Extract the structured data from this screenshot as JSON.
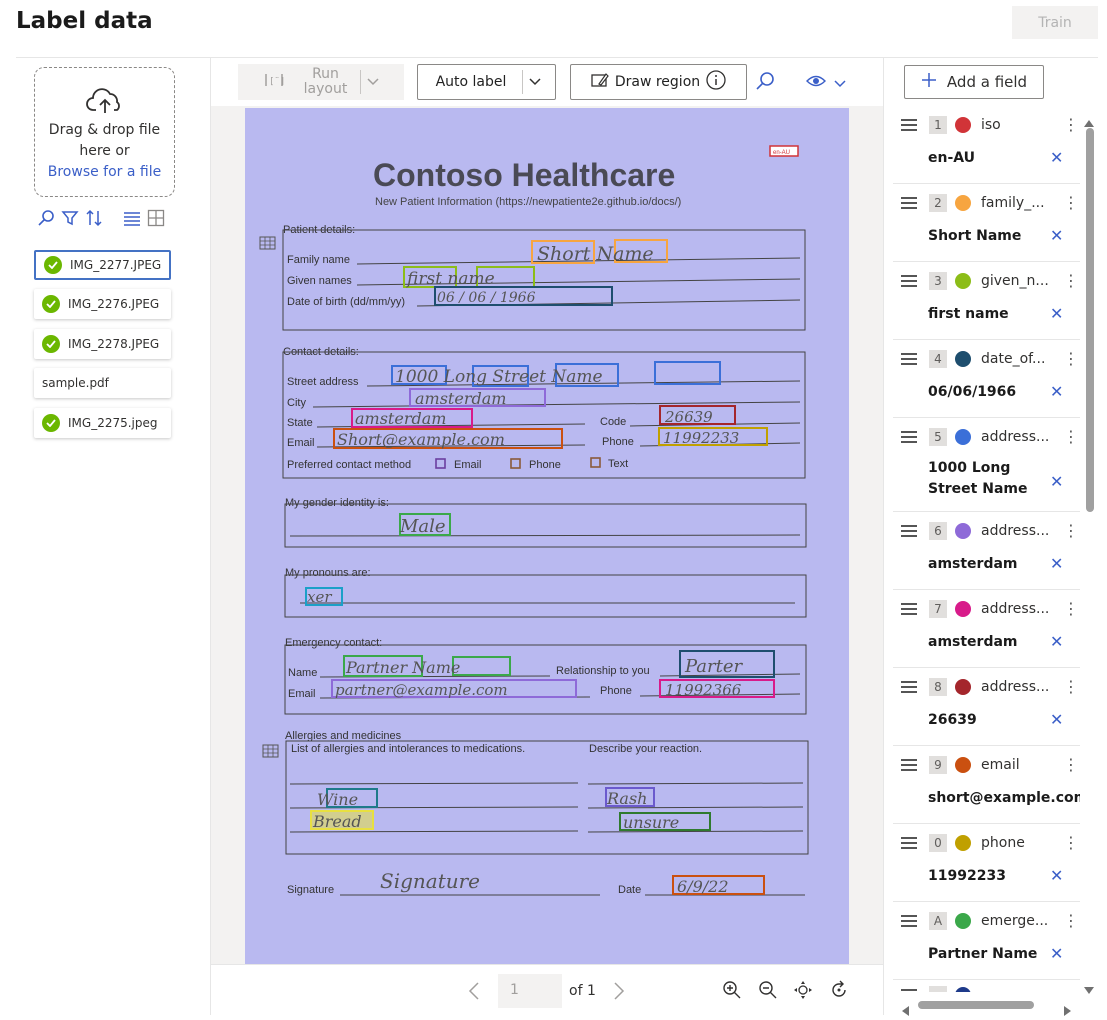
{
  "header": {
    "title": "Label data",
    "train_label": "Train"
  },
  "upload": {
    "line1": "Drag & drop file",
    "line2": "here or",
    "browse": "Browse for a file"
  },
  "files": [
    {
      "name": "IMG_2277.JPEG",
      "labeled": true,
      "selected": true
    },
    {
      "name": "IMG_2276.JPEG",
      "labeled": true,
      "selected": false
    },
    {
      "name": "IMG_2278.JPEG",
      "labeled": true,
      "selected": false
    },
    {
      "name": "sample.pdf",
      "labeled": false,
      "selected": false
    },
    {
      "name": "IMG_2275.jpeg",
      "labeled": true,
      "selected": false
    }
  ],
  "toolbar": {
    "run_layout": "Run layout",
    "auto_label": "Auto label",
    "draw_region": "Draw region"
  },
  "document": {
    "title": "Contoso Healthcare",
    "subtitle": "New Patient Information (https://newpatiente2e.github.io/docs/)",
    "tag": "en-AU",
    "patient_section": "Patient details:",
    "family_name": "Family name",
    "given_names": "Given names",
    "dob": "Date of birth (dd/mm/yy)",
    "hw_family": "Short   Name",
    "hw_given": "first   name",
    "hw_dob": "06 / 06 / 1966",
    "contact_section": "Contact details:",
    "street": "Street address",
    "city": "City",
    "state": "State",
    "code": "Code",
    "email": "Email",
    "phone": "Phone",
    "hw_street": "1000  Long  Street  Name",
    "hw_city": "amsterdam",
    "hw_state": "amsterdam",
    "hw_code": "26639",
    "hw_email": "Short@example.com",
    "hw_phone": "11992233",
    "preferred": "Preferred contact method",
    "opt_email": "Email",
    "opt_phone": "Phone",
    "opt_text": "Text",
    "gender_section": "My gender identity is:",
    "hw_gender": "Male",
    "pronoun_section": "My pronouns are:",
    "hw_pronoun": "xer",
    "emergency_section": "Emergency contact:",
    "name": "Name",
    "relationship": "Relationship to you",
    "hw_em_name": "Partner  Name",
    "hw_rel": "Parter",
    "hw_em_email": "partner@example.com",
    "hw_em_phone": "11992366",
    "allergy_section": "Allergies and medicines",
    "allergy_list": "List of allergies and intolerances to medications.",
    "reaction": "Describe your reaction.",
    "hw_a1": "Wine",
    "hw_a2": "Bread",
    "hw_r1": "Rash",
    "hw_r2": "unsure",
    "signature": "Signature",
    "date": "Date",
    "hw_signature": "Signature",
    "hw_date": "6/9/22"
  },
  "pager": {
    "page": "1",
    "of": "of 1"
  },
  "fields_panel": {
    "add_label": "Add a field"
  },
  "fields": [
    {
      "id": "1",
      "name": "iso",
      "value": "en-AU",
      "color": "#d13438"
    },
    {
      "id": "2",
      "name": "family_...",
      "value": "Short Name",
      "color": "#f7a540"
    },
    {
      "id": "3",
      "name": "given_n...",
      "value": "first name",
      "color": "#8cbd18"
    },
    {
      "id": "4",
      "name": "date_of...",
      "value": "06/06/1966",
      "color": "#1e4e6e"
    },
    {
      "id": "5",
      "name": "address...",
      "value": "1000 Long Street Name",
      "color": "#3b6fd8"
    },
    {
      "id": "6",
      "name": "address...",
      "value": "amsterdam",
      "color": "#8e6ad8"
    },
    {
      "id": "7",
      "name": "address...",
      "value": "amsterdam",
      "color": "#d81b8a"
    },
    {
      "id": "8",
      "name": "address...",
      "value": "26639",
      "color": "#a4262c"
    },
    {
      "id": "9",
      "name": "email",
      "value": "short@example.com",
      "color": "#ca5010"
    },
    {
      "id": "0",
      "name": "phone",
      "value": "11992233",
      "color": "#c0a000"
    },
    {
      "id": "A",
      "name": "emerge...",
      "value": "Partner Name",
      "color": "#3ba84a"
    }
  ]
}
